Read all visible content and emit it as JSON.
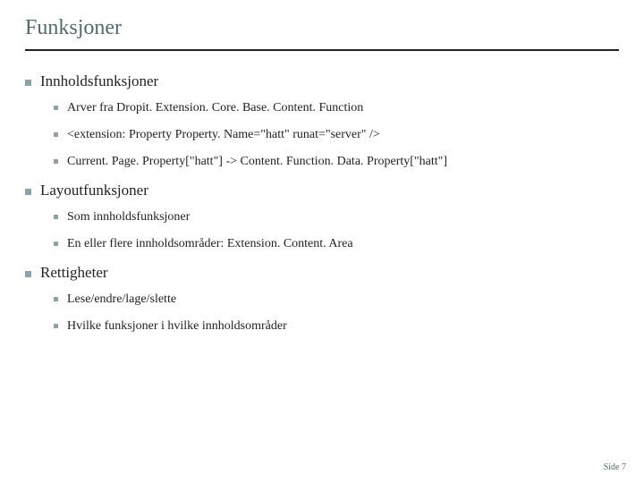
{
  "title": "Funksjoner",
  "sections": [
    {
      "heading": "Innholdsfunksjoner",
      "items": [
        "Arver fra Dropit. Extension. Core. Base. Content. Function",
        "<extension: Property Property. Name=\"hatt\" runat=\"server\" />",
        "Current. Page. Property[\"hatt\"] -> Content. Function. Data. Property[\"hatt\"]"
      ]
    },
    {
      "heading": "Layoutfunksjoner",
      "items": [
        "Som innholdsfunksjoner",
        "En eller flere innholdsområder: Extension. Content. Area"
      ]
    },
    {
      "heading": "Rettigheter",
      "items": [
        "Lese/endre/lage/slette",
        "Hvilke funksjoner i hvilke innholdsområder"
      ]
    }
  ],
  "footer": "Side 7"
}
